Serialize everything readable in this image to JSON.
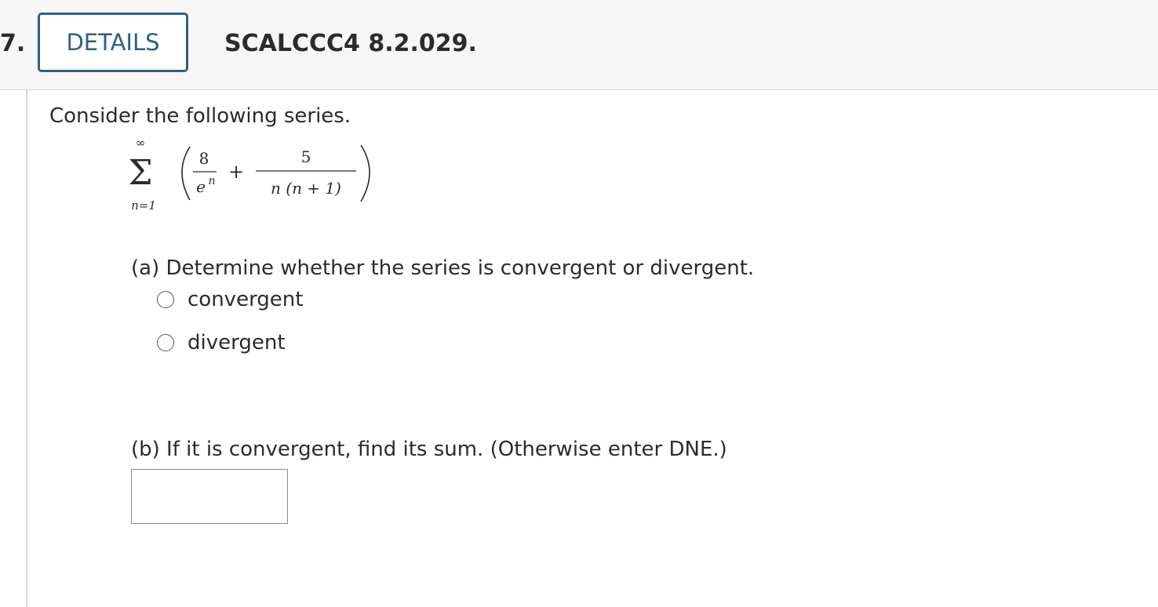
{
  "header": {
    "question_number": "7.",
    "details_label": "DETAILS",
    "problem_id": "SCALCCC4 8.2.029."
  },
  "question": {
    "intro": "Consider the following series.",
    "formula": {
      "upper_limit": "∞",
      "lower_limit": "n=1",
      "term1_numerator": "8",
      "term1_denominator_base": "e",
      "term1_denominator_exponent": "n",
      "operator": "+",
      "term2_numerator": "5",
      "term2_denominator": "n (n + 1)"
    },
    "part_a": {
      "prompt": "(a) Determine whether the series is convergent or divergent.",
      "options": [
        "convergent",
        "divergent"
      ]
    },
    "part_b": {
      "prompt": "(b) If it is convergent, find its sum. (Otherwise enter DNE.)",
      "answer_value": ""
    }
  }
}
